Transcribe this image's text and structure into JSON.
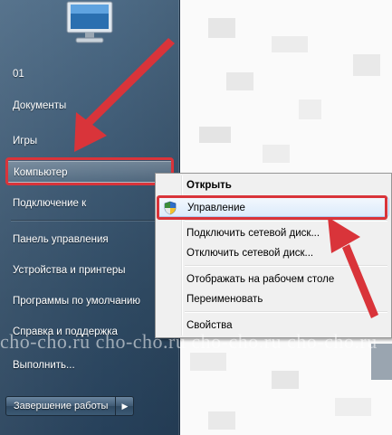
{
  "start_menu": {
    "items": [
      {
        "label": "01"
      },
      {
        "label": "Документы"
      },
      {
        "label": "Игры"
      },
      {
        "label": "Компьютер"
      },
      {
        "label": "Подключение к"
      },
      {
        "label": "Панель управления"
      },
      {
        "label": "Устройства и принтеры"
      },
      {
        "label": "Программы по умолчанию"
      },
      {
        "label": "Справка и поддержка"
      },
      {
        "label": "Выполнить..."
      }
    ],
    "shutdown_label": "Завершение работы",
    "shutdown_arrow": "▶"
  },
  "context_menu": {
    "items": [
      {
        "label": "Открыть"
      },
      {
        "label": "Управление"
      },
      {
        "label": "Подключить сетевой диск..."
      },
      {
        "label": "Отключить сетевой диск..."
      },
      {
        "label": "Отображать на рабочем столе"
      },
      {
        "label": "Переименовать"
      },
      {
        "label": "Свойства"
      }
    ]
  },
  "watermark": "cho-cho.ru cho-cho.ru cho-cho.ru cho-cho.ru",
  "colors": {
    "annotation": "#d9343a",
    "menu_bg": "#f0f0f0",
    "pane_top": "#4d6b86"
  }
}
